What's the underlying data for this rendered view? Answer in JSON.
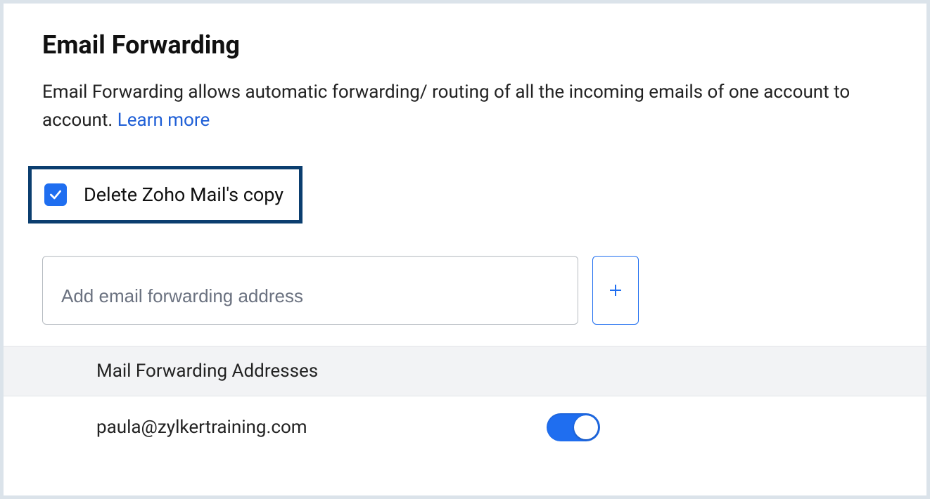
{
  "header": {
    "title": "Email Forwarding",
    "description_prefix": "Email Forwarding allows automatic forwarding/ routing of all the incoming emails of one account to account. ",
    "learn_more_label": "Learn more"
  },
  "delete_copy": {
    "checked": true,
    "label": "Delete Zoho Mail's copy"
  },
  "input": {
    "placeholder": "Add email forwarding address",
    "value": ""
  },
  "table": {
    "header_label": "Mail Forwarding Addresses",
    "rows": [
      {
        "email": "paula@zylkertraining.com",
        "enabled": true
      }
    ]
  }
}
